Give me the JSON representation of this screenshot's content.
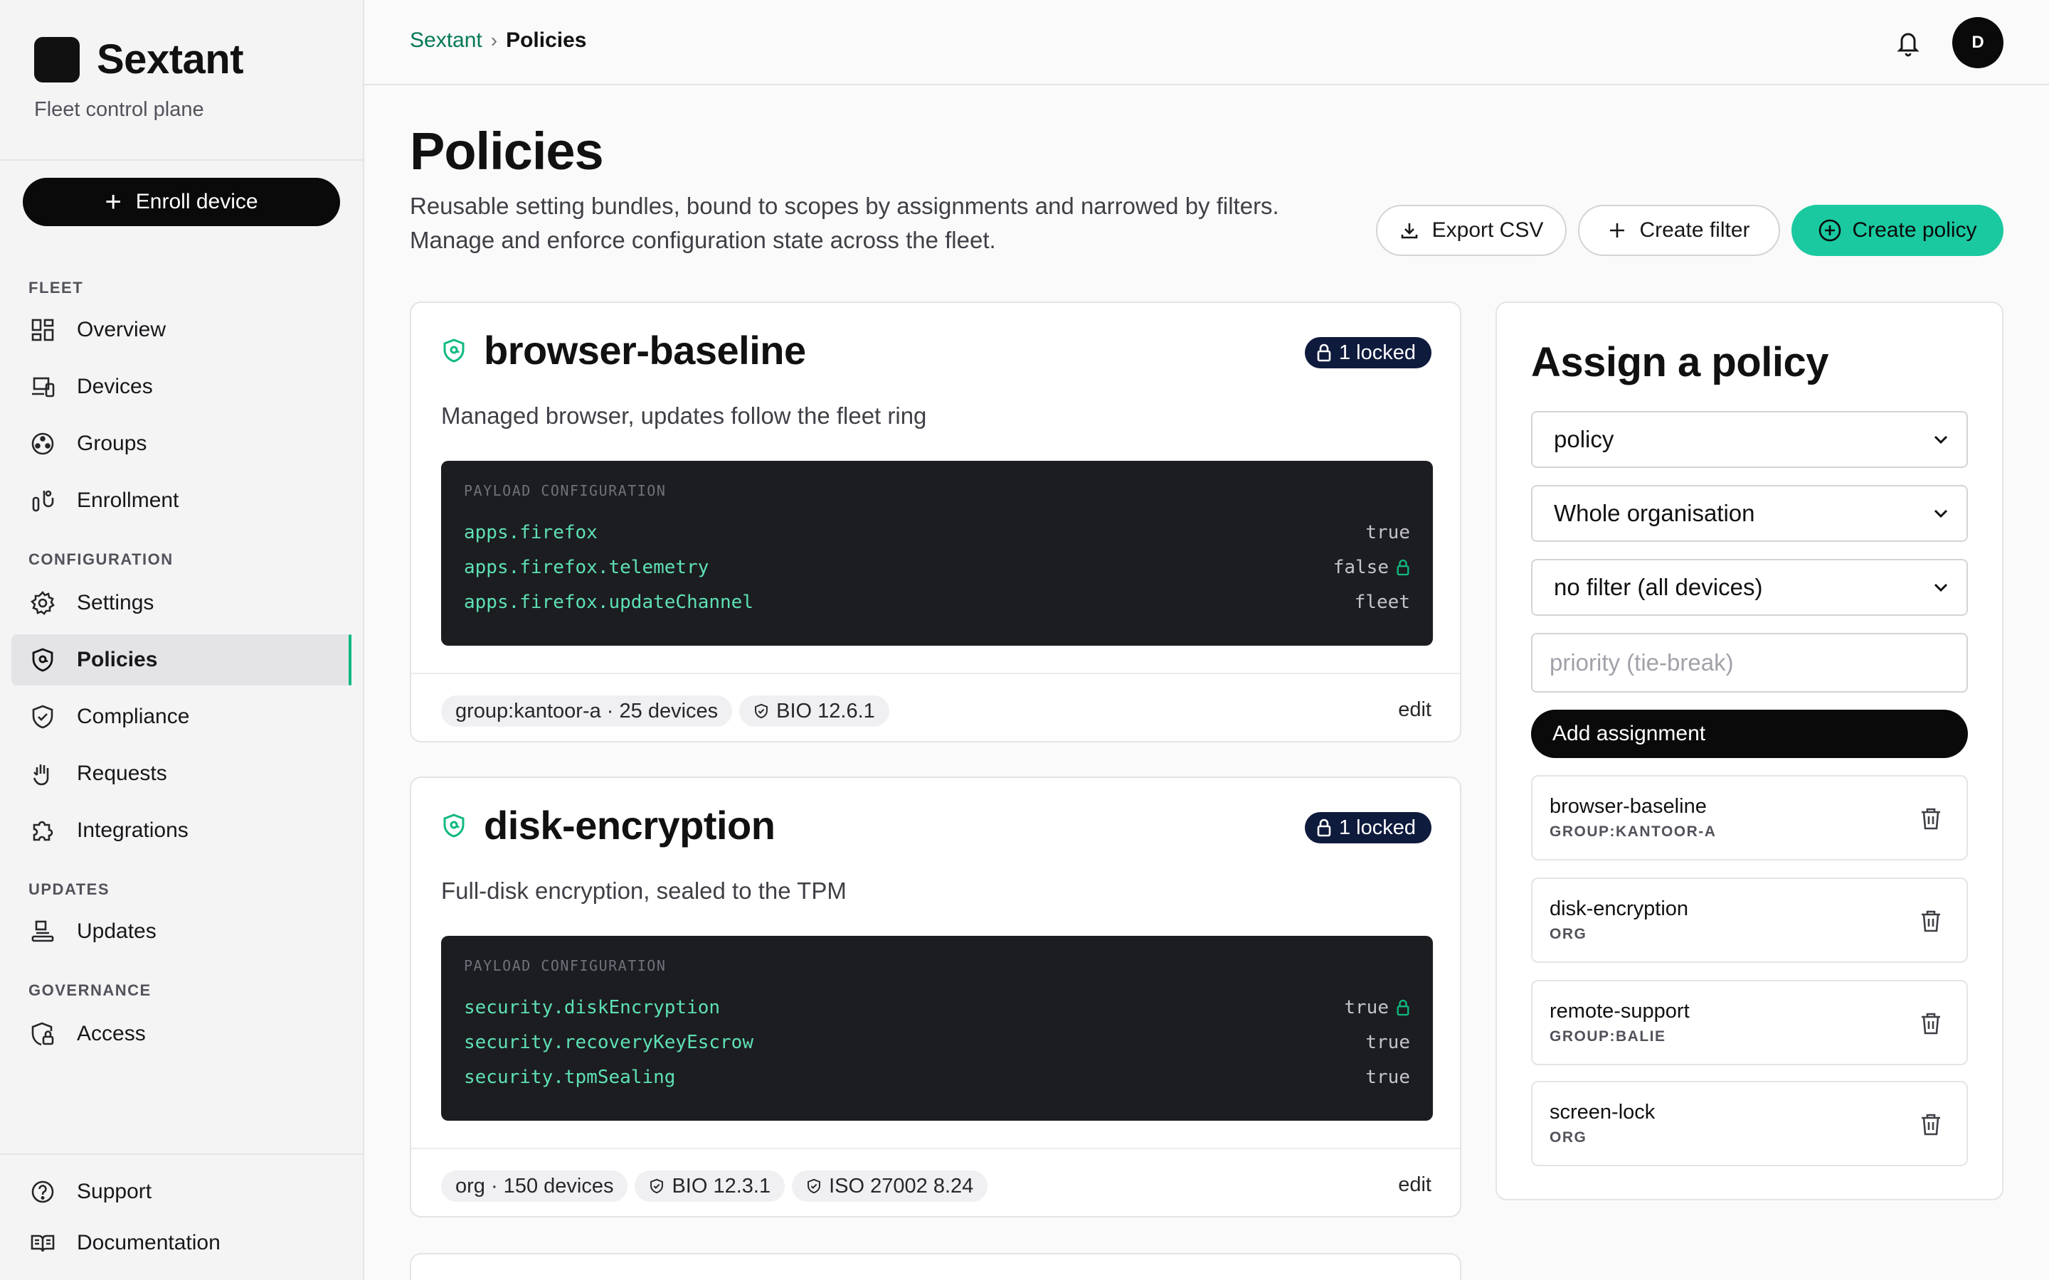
{
  "brand": {
    "name": "Sextant",
    "subtitle": "Fleet control plane"
  },
  "sidebar": {
    "enroll_label": "Enroll device",
    "sections": {
      "fleet": "FLEET",
      "configuration": "CONFIGURATION",
      "updates": "UPDATES",
      "governance": "GOVERNANCE"
    },
    "items": {
      "overview": "Overview",
      "devices": "Devices",
      "groups": "Groups",
      "enrollment": "Enrollment",
      "settings": "Settings",
      "policies": "Policies",
      "compliance": "Compliance",
      "requests": "Requests",
      "integrations": "Integrations",
      "updates": "Updates",
      "access": "Access",
      "support": "Support",
      "documentation": "Documentation"
    },
    "active": "policies"
  },
  "topbar": {
    "breadcrumb_root": "Sextant",
    "breadcrumb_current": "Policies",
    "avatar_initial": "D"
  },
  "header": {
    "title": "Policies",
    "description": "Reusable setting bundles, bound to scopes by assignments and narrowed by filters. Manage and enforce configuration state across the fleet.",
    "export_label": "Export CSV",
    "create_filter_label": "Create filter",
    "create_policy_label": "Create policy"
  },
  "policies": [
    {
      "name": "browser-baseline",
      "locked": "1 locked",
      "description": "Managed browser, updates follow the fleet ring",
      "payload_label": "PAYLOAD CONFIGURATION",
      "payload": [
        {
          "key": "apps.firefox",
          "value": "true",
          "locked": false
        },
        {
          "key": "apps.firefox.telemetry",
          "value": "false",
          "locked": true
        },
        {
          "key": "apps.firefox.updateChannel",
          "value": "fleet",
          "locked": false
        }
      ],
      "scope_tag": "group:kantoor-a · 25 devices",
      "compliance_tags": [
        "BIO 12.6.1"
      ],
      "edit_label": "edit"
    },
    {
      "name": "disk-encryption",
      "locked": "1 locked",
      "description": "Full-disk encryption, sealed to the TPM",
      "payload_label": "PAYLOAD CONFIGURATION",
      "payload": [
        {
          "key": "security.diskEncryption",
          "value": "true",
          "locked": true
        },
        {
          "key": "security.recoveryKeyEscrow",
          "value": "true",
          "locked": false
        },
        {
          "key": "security.tpmSealing",
          "value": "true",
          "locked": false
        }
      ],
      "scope_tag": "org · 150 devices",
      "compliance_tags": [
        "BIO 12.3.1",
        "ISO 27002 8.24"
      ],
      "edit_label": "edit"
    }
  ],
  "assign": {
    "title": "Assign a policy",
    "policy_select": "policy",
    "scope_select": "Whole organisation",
    "filter_select": "no filter (all devices)",
    "priority_placeholder": "priority (tie-break)",
    "add_label": "Add assignment",
    "assignments": [
      {
        "name": "browser-baseline",
        "scope": "GROUP:KANTOOR-A"
      },
      {
        "name": "disk-encryption",
        "scope": "ORG"
      },
      {
        "name": "remote-support",
        "scope": "GROUP:BALIE"
      },
      {
        "name": "screen-lock",
        "scope": "ORG"
      }
    ]
  },
  "colors": {
    "accent": "#1ac9a0",
    "accent_dark": "#047857",
    "badge": "#0f1b3d",
    "code_bg": "#1c1d21"
  }
}
